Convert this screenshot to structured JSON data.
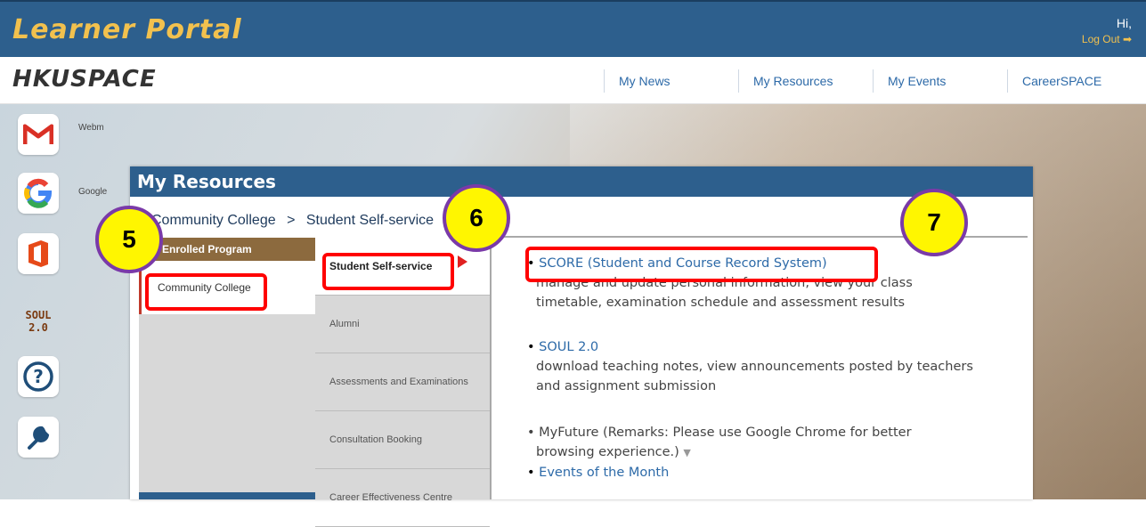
{
  "header": {
    "title": "Learner Portal",
    "greeting": "Hi,",
    "logout_label": "Log Out"
  },
  "brand": {
    "logo_text": "HKUSPACE"
  },
  "nav": {
    "items": [
      "My News",
      "My Resources",
      "My Events",
      "CareerSPACE"
    ]
  },
  "rail": {
    "items": [
      {
        "icon": "gmail-icon",
        "label": "Webm"
      },
      {
        "icon": "google-icon",
        "label": "Google"
      },
      {
        "icon": "office-icon",
        "label": ""
      },
      {
        "icon": "soul-icon",
        "label": "",
        "text": "SOUL\n2.0"
      },
      {
        "icon": "help-icon",
        "label": ""
      },
      {
        "icon": "wrench-icon",
        "label": ""
      }
    ]
  },
  "panel": {
    "title": "My Resources",
    "breadcrumb": {
      "root": "Community College",
      "separator": ">",
      "current": "Student Self-service"
    },
    "program_header": "Enrolled Program",
    "program_item": "Community College",
    "categories": [
      "Student Self-service",
      "Alumni",
      "Assessments and Examinations",
      "Consultation Booking",
      "Career Effectiveness Centre"
    ],
    "resources": [
      {
        "title": "SCORE (Student and Course Record System)",
        "desc_line1": "manage and update personal information, view your class",
        "desc_line2": "timetable, examination schedule and assessment results"
      },
      {
        "title": "SOUL 2.0",
        "desc_line1": "download teaching notes, view announcements posted by teachers",
        "desc_line2": "and assignment submission"
      },
      {
        "title_line1": "MyFuture (Remarks: Please use Google Chrome for better",
        "title_line2": "browsing experience.)"
      },
      {
        "title": "Events of the Month"
      }
    ]
  },
  "annotations": {
    "step5": "5",
    "step6": "6",
    "step7": "7"
  },
  "colors": {
    "header_blue": "#2d5f8d",
    "accent_gold": "#f2c14e",
    "link_blue": "#2d6aa8",
    "highlight_red": "#ff0000",
    "callout_yellow": "#fff600",
    "callout_border": "#7a3aa8"
  }
}
